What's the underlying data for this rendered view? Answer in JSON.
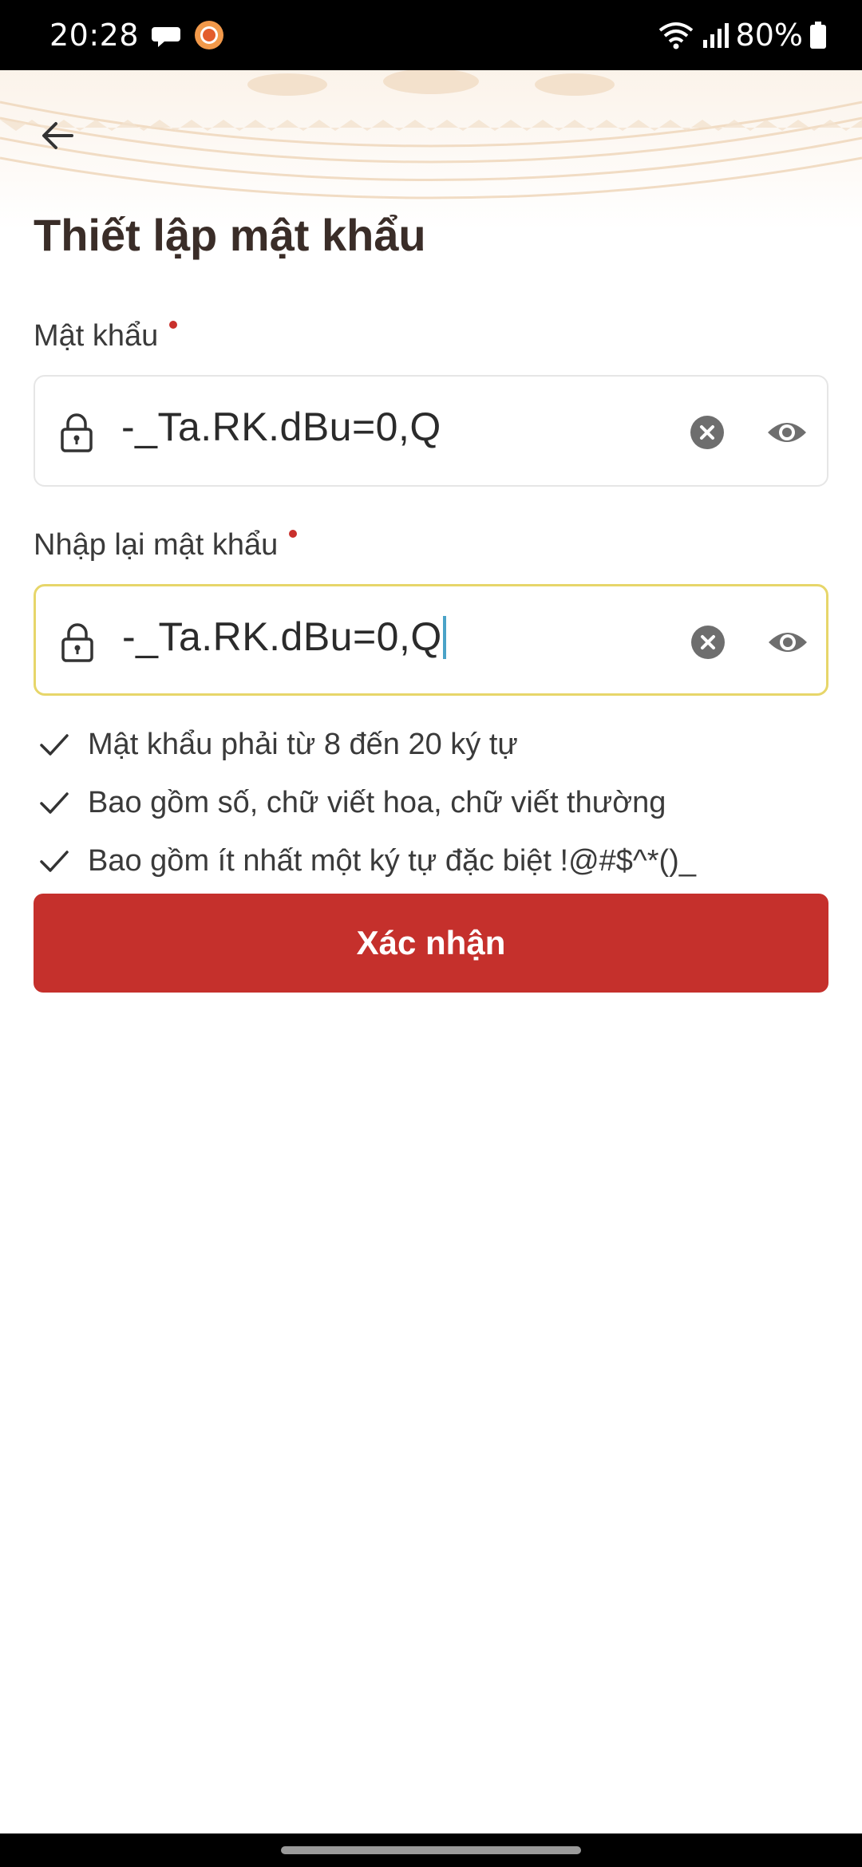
{
  "status_bar": {
    "time": "20:28",
    "battery": "80%"
  },
  "header": {
    "back_icon": "arrow-left-icon",
    "title": "Thiết lập mật khẩu"
  },
  "form": {
    "password": {
      "label": "Mật khẩu",
      "value": "-_Ta.RK.dBu=0,Q",
      "leading_icon": "lock-icon",
      "clear_icon": "clear-icon",
      "toggle_icon": "eye-icon"
    },
    "confirm_password": {
      "label": "Nhập lại mật khẩu",
      "value": "-_Ta.RK.dBu=0,Q",
      "leading_icon": "lock-icon",
      "clear_icon": "clear-icon",
      "toggle_icon": "eye-icon",
      "focused": true
    },
    "rules": [
      {
        "text": "Mật khẩu phải từ 8 đến 20 ký tự",
        "icon": "check-icon"
      },
      {
        "text": "Bao gồm số, chữ viết hoa, chữ viết thường",
        "icon": "check-icon"
      },
      {
        "text": "Bao gồm ít nhất một ký tự đặc biệt !@#$^*()_",
        "icon": "check-icon"
      }
    ],
    "submit_label": "Xác nhận"
  },
  "colors": {
    "primary": "#c5302c",
    "required_dot": "#c9302c",
    "focus_border": "#e7d66a",
    "title": "#3a2d28"
  }
}
